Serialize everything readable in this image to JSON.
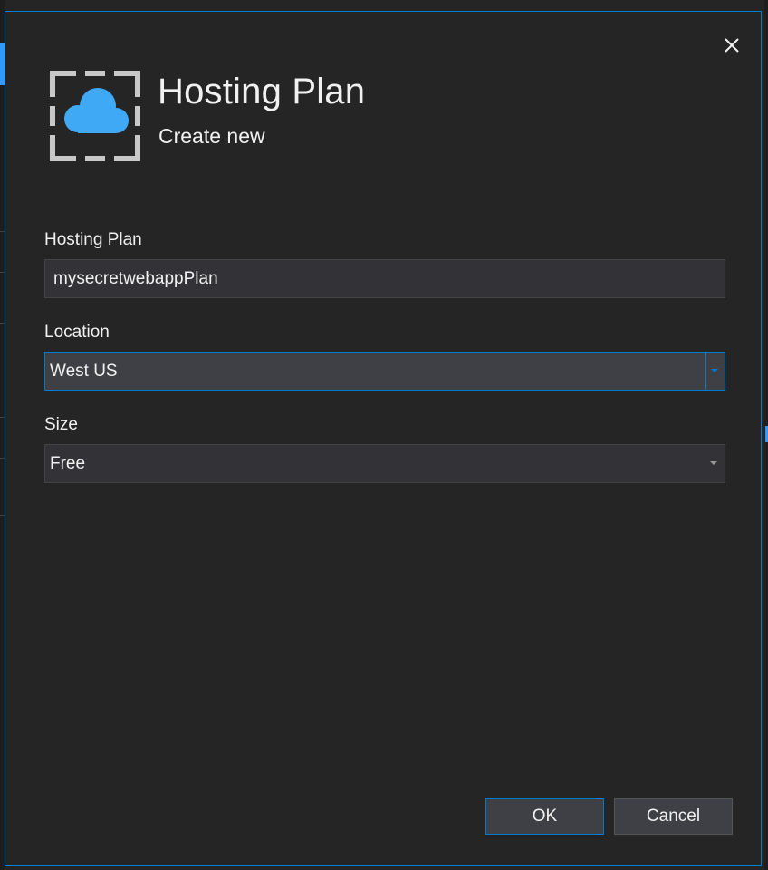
{
  "dialog": {
    "title": "Hosting Plan",
    "subtitle": "Create new",
    "close_icon": "close-icon",
    "header_icon": "cloud-frame-icon"
  },
  "form": {
    "hosting_plan": {
      "label": "Hosting Plan",
      "value": "mysecretwebappPlan"
    },
    "location": {
      "label": "Location",
      "value": "West US"
    },
    "size": {
      "label": "Size",
      "value": "Free"
    }
  },
  "buttons": {
    "ok_label": "OK",
    "cancel_label": "Cancel"
  },
  "colors": {
    "accent": "#007acc",
    "cloud": "#3fa9f5",
    "frame": "#c8c8c8",
    "background": "#252526",
    "input_background": "#333337"
  }
}
